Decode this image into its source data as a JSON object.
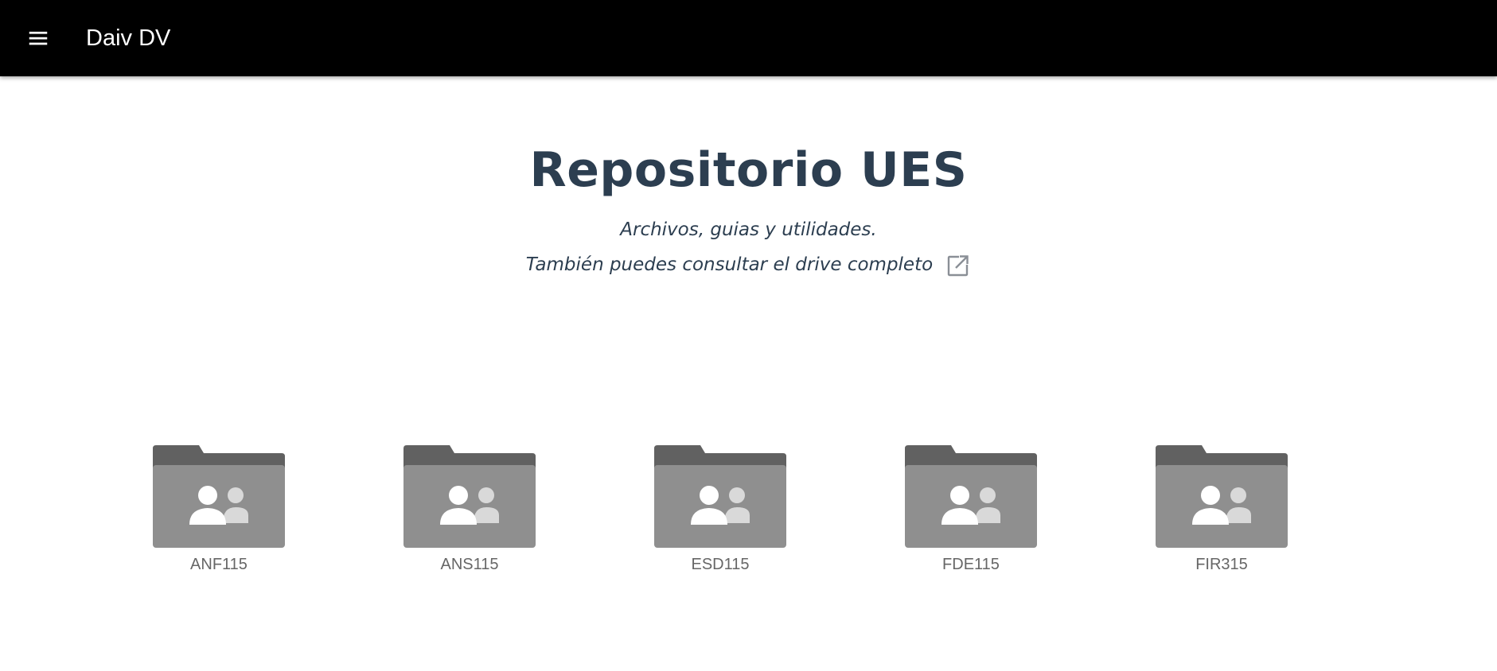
{
  "app_bar": {
    "title": "Daiv DV",
    "menu_icon": "menu-icon",
    "background": "#000000"
  },
  "hero": {
    "title": "Repositorio UES",
    "subtitle": "Archivos, guias y utilidades.",
    "drive_link_text": "También puedes consultar el drive completo",
    "drive_link_icon": "open-in-new-icon",
    "text_color": "#2c3e50"
  },
  "folders": [
    {
      "label": "ANF115",
      "icon": "shared-folder-icon"
    },
    {
      "label": "ANS115",
      "icon": "shared-folder-icon"
    },
    {
      "label": "ESD115",
      "icon": "shared-folder-icon"
    },
    {
      "label": "FDE115",
      "icon": "shared-folder-icon"
    },
    {
      "label": "FIR315",
      "icon": "shared-folder-icon"
    }
  ]
}
